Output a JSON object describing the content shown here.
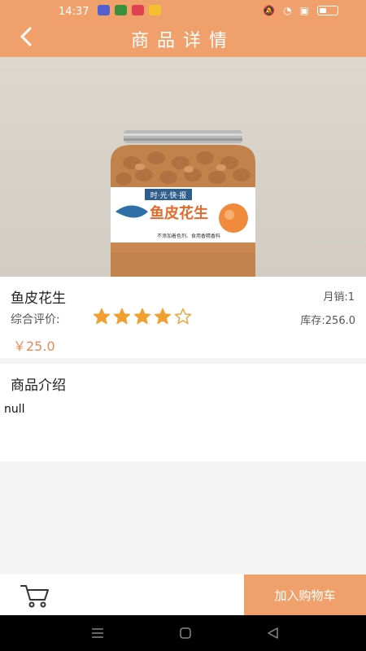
{
  "status_bar": {
    "time": "14:37"
  },
  "header": {
    "title": "商品详情",
    "back_icon": "chevron-left-icon"
  },
  "product": {
    "image_alt": "鱼皮花生",
    "brand_label": "时·光·快·报",
    "package_text": "鱼皮花生",
    "package_tagline": "不添加着色剂、食用香精香料",
    "name": "鱼皮花生",
    "monthly_sales": "月销:1",
    "rating_label": "综合评价:",
    "rating": 4,
    "rating_max": 5,
    "stock": "库存:256.0",
    "price": "￥25.0"
  },
  "intro": {
    "title": "商品介绍",
    "body": "null"
  },
  "bottom_bar": {
    "cart_icon": "cart-icon",
    "add_to_cart": "加入购物车"
  },
  "colors": {
    "accent": "#f0a06a",
    "price": "#e8895a",
    "star": "#f0a030"
  }
}
